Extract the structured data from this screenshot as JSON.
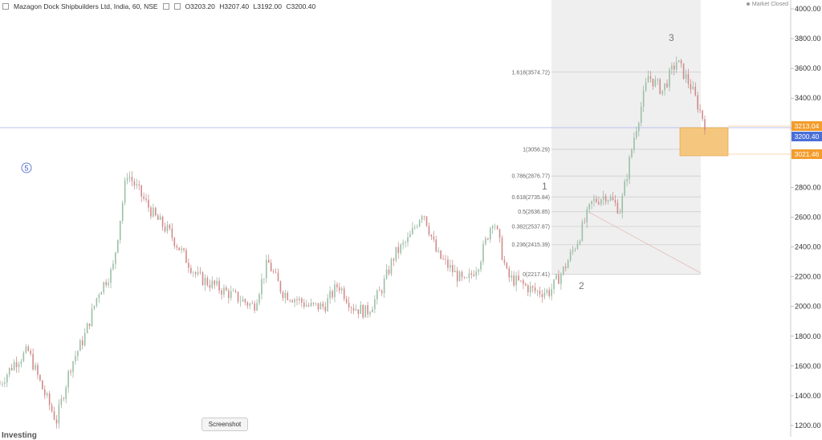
{
  "header": {
    "title": "Mazagon Dock Shipbuilders Ltd, India, 60, NSE",
    "open": "O3203.20",
    "high": "H3207.40",
    "low": "L3192.00",
    "close": "C3200.40"
  },
  "market_status": "Market Closed",
  "price_tags": {
    "upper": "3213.04",
    "current": "3200.40",
    "lower": "3021.46"
  },
  "screenshot_label": "Screenshot",
  "watermark": "Investing",
  "wave_labels": {
    "w5": "5",
    "w1": "1",
    "w2": "2",
    "w3": "3"
  },
  "colors": {
    "up": "#26a69a",
    "down": "#ef5350",
    "candle": "#c98080",
    "shade": "#efefef",
    "box": "#f5c77e",
    "tag_orange": "#f39c2b",
    "tag_blue": "#4a6fd8"
  },
  "chart_data": {
    "type": "line",
    "ylim": [
      1150,
      4050
    ],
    "y_ticks": [
      "4000.00",
      "3800.00",
      "3600.00",
      "3400.00",
      "3200.00",
      "2800.00",
      "2600.00",
      "2400.00",
      "2200.00",
      "2000.00",
      "1800.00",
      "1600.00",
      "1400.00",
      "1200.00"
    ],
    "y_tick_values": [
      4000,
      3800,
      3600,
      3400,
      3200,
      2800,
      2600,
      2400,
      2200,
      2000,
      1800,
      1600,
      1400,
      1200
    ],
    "fib_levels": [
      {
        "label": "1.618(3574.72)",
        "value": 3574.72
      },
      {
        "label": "1(3056.29)",
        "value": 3056.29
      },
      {
        "label": "0.786(2876.77)",
        "value": 2876.77
      },
      {
        "label": "0.618(2735.84)",
        "value": 2735.84
      },
      {
        "label": "0.5(2636.85)",
        "value": 2636.85
      },
      {
        "label": "0.382(2537.87)",
        "value": 2537.87
      },
      {
        "label": "0.236(2415.39)",
        "value": 2415.39
      },
      {
        "label": "0(2217.41)",
        "value": 2217.41
      }
    ],
    "price_series": [
      1480,
      1620,
      1700,
      1450,
      1230,
      1600,
      1800,
      2100,
      2250,
      2900,
      2750,
      2600,
      2500,
      2350,
      2200,
      2150,
      2100,
      2050,
      2000,
      2300,
      2100,
      2050,
      2000,
      2000,
      2150,
      2000,
      1960,
      2100,
      2350,
      2450,
      2650,
      2350,
      2250,
      2150,
      2300,
      2600,
      2200,
      2150,
      2100,
      2100,
      2250,
      2450,
      2700,
      2750,
      2650,
      3150,
      3550,
      3450,
      3650,
      3480,
      3230
    ]
  }
}
